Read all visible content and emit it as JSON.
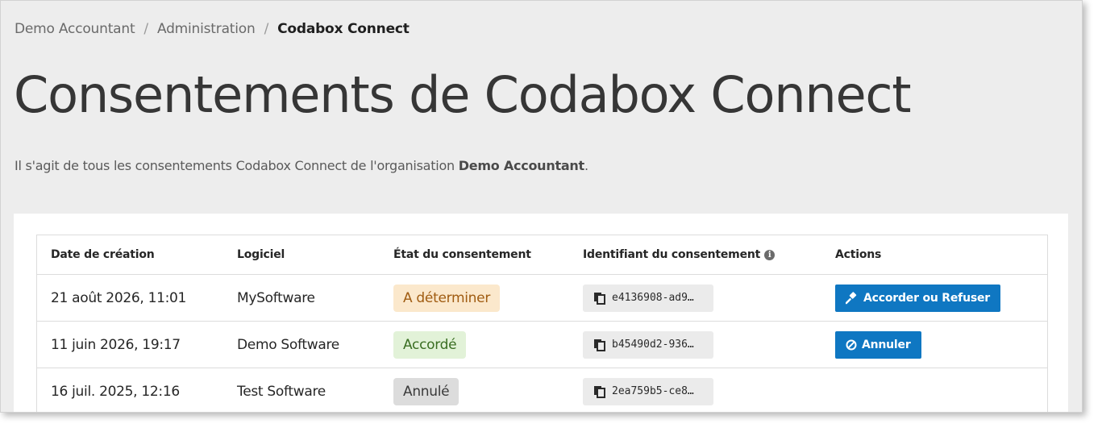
{
  "breadcrumb": {
    "items": [
      "Demo Accountant",
      "Administration"
    ],
    "separator": "/",
    "current": "Codabox Connect"
  },
  "page": {
    "title": "Consentements de Codabox Connect",
    "subtitle_prefix": "Il s'agit de tous les consentements Codabox Connect de l'organisation ",
    "subtitle_org": "Demo Accountant",
    "subtitle_suffix": "."
  },
  "table": {
    "headers": {
      "created": "Date de création",
      "software": "Logiciel",
      "status": "État du consentement",
      "identifier": "Identifiant du consentement",
      "actions": "Actions"
    },
    "rows": [
      {
        "created": "21 août 2026, 11:01",
        "software": "MySoftware",
        "status": "A déterminer",
        "identifier": "e4136908-ad9…",
        "action": "Accorder ou Refuser"
      },
      {
        "created": "11 juin 2026, 19:17",
        "software": "Demo Software",
        "status": "Accordé",
        "identifier": "b45490d2-936…",
        "action": "Annuler"
      },
      {
        "created": "16 juil. 2025, 12:16",
        "software": "Test Software",
        "status": "Annulé",
        "identifier": "2ea759b5-ce8…",
        "action": ""
      }
    ]
  },
  "icons": {
    "info": "info-icon",
    "copy": "copy-icon",
    "gavel": "gavel-icon",
    "cancel": "ban-icon"
  },
  "colors": {
    "primary_button": "#0f77c2",
    "pending_bg": "#fbe8cc",
    "granted_bg": "#e2f2d8",
    "cancelled_bg": "#dcdcdc",
    "page_bg": "#ededed"
  }
}
